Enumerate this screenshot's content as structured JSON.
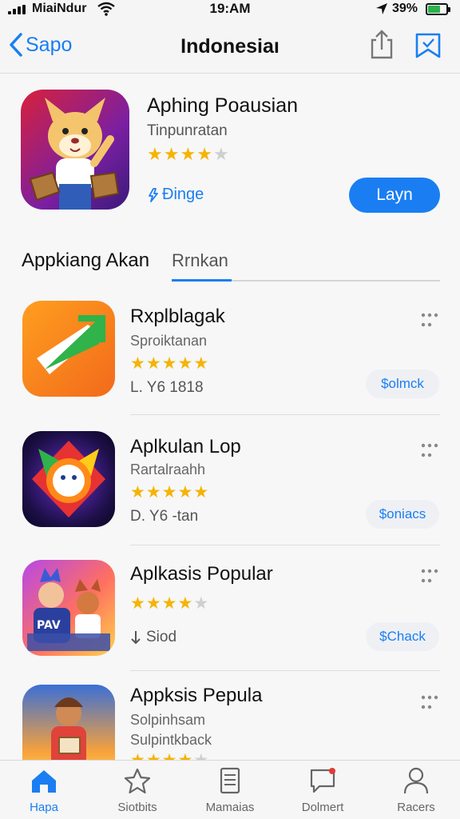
{
  "status": {
    "carrier": "MiaiNdur",
    "time": "19:AM",
    "battery": "39%",
    "battery_level": 0.7
  },
  "nav": {
    "back_label": "Sapo",
    "title": "Indonesiaı"
  },
  "featured": {
    "name": "Aphing Poausian",
    "subtitle": "Tinpunratan",
    "rating": 4,
    "stars_total": 5,
    "category": "Ðinge",
    "button": "Layn"
  },
  "section": {
    "title": "Appkiang Akan",
    "tab": "Rrnkan"
  },
  "apps": [
    {
      "name": "Rxplblagak",
      "subtitle": "Sproiktanan",
      "rating": 5,
      "meta": "L. Y6 1818",
      "button": "$olmck"
    },
    {
      "name": "Aplkulan Lop",
      "subtitle": "Rartalraahh",
      "rating": 5,
      "meta": "D. Y6 -tan",
      "button": "$oniacs"
    },
    {
      "name": "Aplkasis Popular",
      "rating": 4,
      "meta": "Siod",
      "button": "$Chack"
    },
    {
      "name": "Appksis Pepula",
      "subtitle": "Solpinhsam",
      "subtitle2": "Sulpintkback",
      "rating": 4
    }
  ],
  "tabs": [
    {
      "label": "Hapa",
      "icon": "home-icon",
      "active": true
    },
    {
      "label": "Siotbits",
      "icon": "star-icon",
      "active": false
    },
    {
      "label": "Mamaias",
      "icon": "document-icon",
      "active": false
    },
    {
      "label": "Dolmert",
      "icon": "chat-icon",
      "active": false
    },
    {
      "label": "Racers",
      "icon": "person-icon",
      "active": false
    }
  ],
  "colors": {
    "accent": "#1a7ef2",
    "star": "#f5b400",
    "star_off": "#cfcfcf"
  }
}
